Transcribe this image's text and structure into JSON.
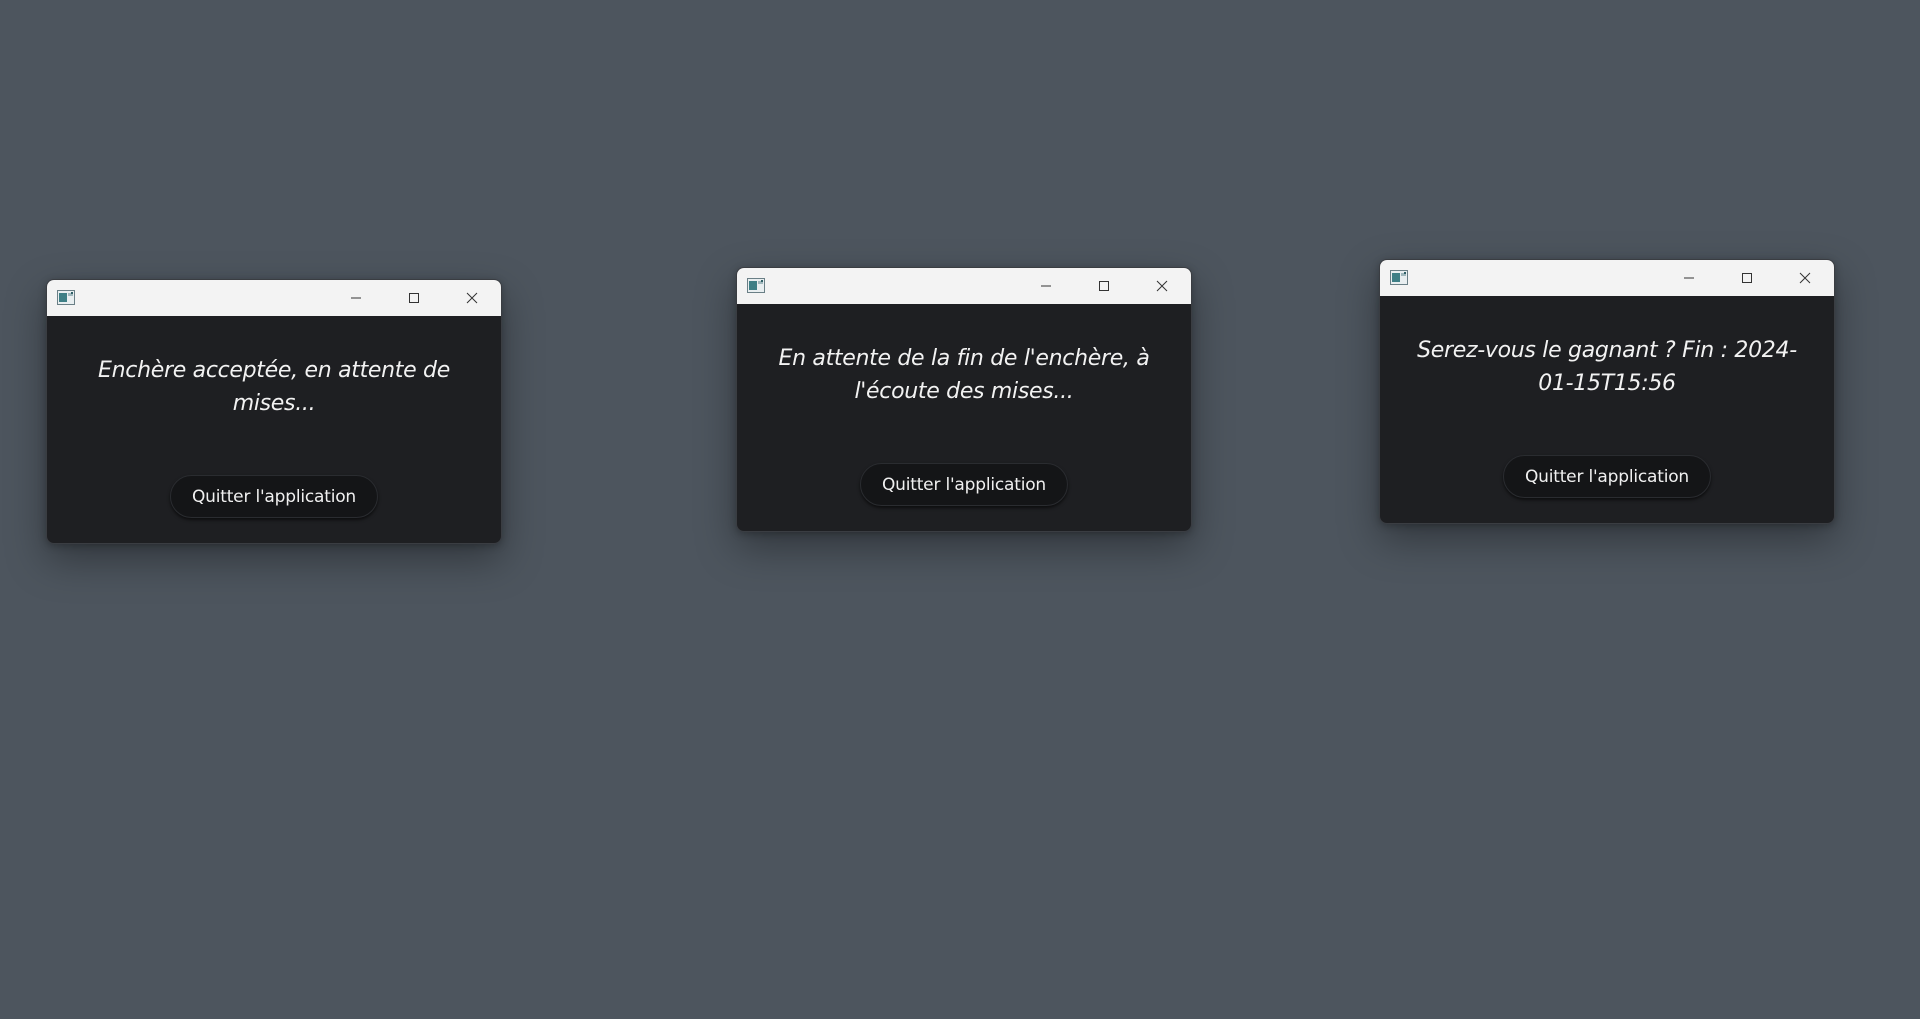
{
  "windows": [
    {
      "message": "Enchère acceptée, en attente de mises...",
      "button_label": "Quitter l'application"
    },
    {
      "message": "En attente de la fin de l'enchère, à l'écoute des mises...",
      "button_label": "Quitter l'application"
    },
    {
      "message": "Serez-vous le gagnant ? Fin : 2024-01-15T15:56",
      "button_label": "Quitter l'application"
    }
  ],
  "titlebar": {
    "icons": [
      "app-icon",
      "minimize-icon",
      "maximize-icon",
      "close-icon"
    ]
  },
  "colors": {
    "desktop": "#4d555e",
    "window_body": "#1e1f22",
    "titlebar": "#f3f3f3",
    "text": "#f2f2f2",
    "button": "#141517"
  }
}
